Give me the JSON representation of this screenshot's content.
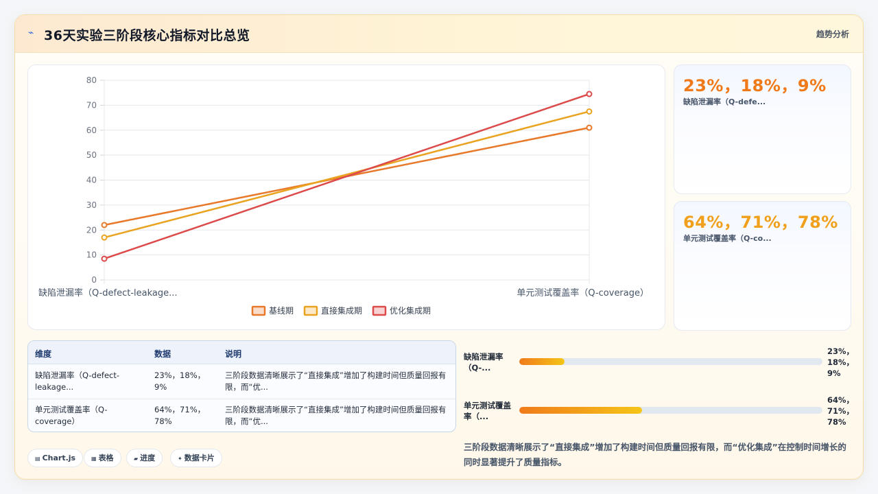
{
  "header": {
    "icon": "trend-icon",
    "title": "36天实验三阶段核心指标对比总览",
    "tag": "趋势分析"
  },
  "chart_data": {
    "type": "line",
    "categories": [
      "缺陷泄漏率（Q-defect-leakage...",
      "单元测试覆盖率（Q-coverage）"
    ],
    "series": [
      {
        "name": "基线期",
        "values": [
          22,
          61
        ],
        "color": "#e8792b"
      },
      {
        "name": "直接集成期",
        "values": [
          17,
          67.5
        ],
        "color": "#eaa320"
      },
      {
        "name": "优化集成期",
        "values": [
          8.5,
          74.5
        ],
        "color": "#dc4a4a"
      }
    ],
    "ylim": [
      0,
      80
    ],
    "yticks": [
      0,
      10,
      20,
      30,
      40,
      50,
      60,
      70,
      80
    ],
    "grid": true,
    "legend": "bottom"
  },
  "kpis": [
    {
      "value": "23%，18%，9%",
      "label": "缺陷泄漏率（Q-defe...",
      "color": "#f07a1a"
    },
    {
      "value": "64%，71%，78%",
      "label": "单元测试覆盖率（Q-co...",
      "color": "#f0a01a"
    }
  ],
  "table": {
    "headers": [
      "维度",
      "数据",
      "说明"
    ],
    "rows": [
      {
        "dim": "缺陷泄漏率（Q-defect-leakage...",
        "data": "23%，18%，9%",
        "desc": "三阶段数据清晰展示了“直接集成”增加了构建时间但质量回报有限，而“优..."
      },
      {
        "dim": "单元测试覆盖率（Q-coverage）",
        "data": "64%，71%，78%",
        "desc": "三阶段数据清晰展示了“直接集成”增加了构建时间但质量回报有限，而“优..."
      }
    ]
  },
  "chips": [
    {
      "icon": "chart-icon",
      "glyph": "▤",
      "label": "Chart.js"
    },
    {
      "icon": "table-icon",
      "glyph": "▦",
      "label": "表格"
    },
    {
      "icon": "progress-icon",
      "glyph": "▰",
      "label": "进度"
    },
    {
      "icon": "sparkle-icon",
      "glyph": "✦",
      "label": "数据卡片"
    }
  ],
  "progress": [
    {
      "label": "缺陷泄漏率（Q-...",
      "value_text": "23%，18%，9%",
      "fraction": 0.15
    },
    {
      "label": "单元测试覆盖率（...",
      "value_text": "64%，71%，78%",
      "fraction": 0.406
    }
  ],
  "summary": "三阶段数据清晰展示了“直接集成”增加了构建时间但质量回报有限，而“优化集成”在控制时间增长的同时显著提升了质量指标。"
}
